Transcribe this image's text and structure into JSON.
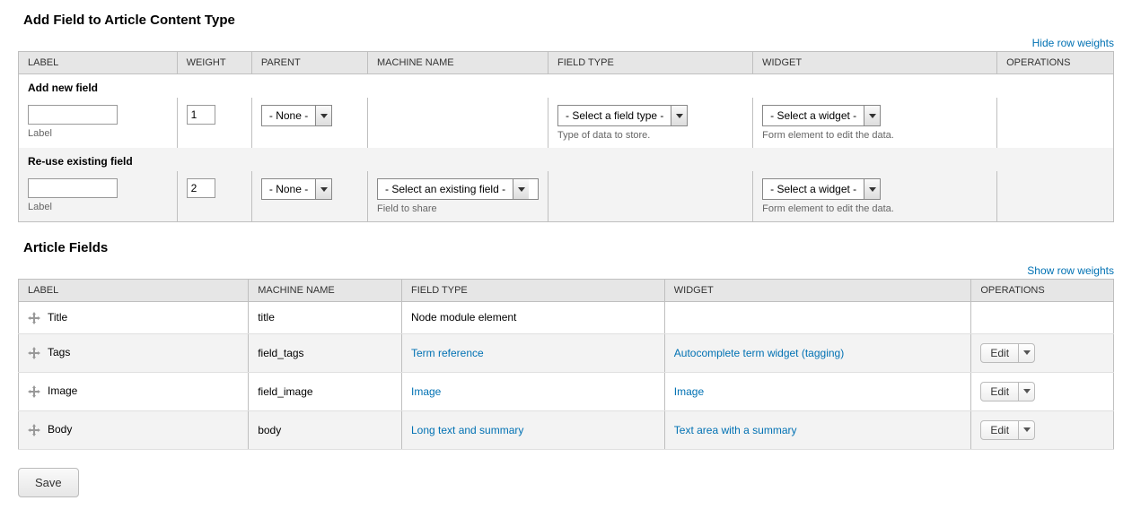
{
  "section1": {
    "title": "Add Field to Article Content Type",
    "toggle": "Hide row weights",
    "headers": [
      "LABEL",
      "WEIGHT",
      "PARENT",
      "MACHINE NAME",
      "FIELD TYPE",
      "WIDGET",
      "OPERATIONS"
    ],
    "add": {
      "heading": "Add new field",
      "label_hint": "Label",
      "weight": "1",
      "parent": "- None -",
      "field_type": "- Select a field type -",
      "field_type_hint": "Type of data to store.",
      "widget": "- Select a widget -",
      "widget_hint": "Form element to edit the data."
    },
    "reuse": {
      "heading": "Re-use existing field",
      "label_hint": "Label",
      "weight": "2",
      "parent": "- None -",
      "existing": "- Select an existing field -",
      "existing_hint": "Field to share",
      "widget": "- Select a widget -",
      "widget_hint": "Form element to edit the data."
    }
  },
  "section2": {
    "title": "Article Fields",
    "toggle": "Show row weights",
    "headers": [
      "LABEL",
      "MACHINE NAME",
      "FIELD TYPE",
      "WIDGET",
      "OPERATIONS"
    ],
    "rows": [
      {
        "label": "Title",
        "machine": "title",
        "type": "Node module element",
        "type_link": false,
        "widget": "",
        "widget_link": false,
        "ops": false
      },
      {
        "label": "Tags",
        "machine": "field_tags",
        "type": "Term reference",
        "type_link": true,
        "widget": "Autocomplete term widget (tagging)",
        "widget_link": true,
        "ops": true
      },
      {
        "label": "Image",
        "machine": "field_image",
        "type": "Image",
        "type_link": true,
        "widget": "Image",
        "widget_link": true,
        "ops": true
      },
      {
        "label": "Body",
        "machine": "body",
        "type": "Long text and summary",
        "type_link": true,
        "widget": "Text area with a summary",
        "widget_link": true,
        "ops": true
      }
    ],
    "edit_label": "Edit"
  },
  "save": "Save"
}
